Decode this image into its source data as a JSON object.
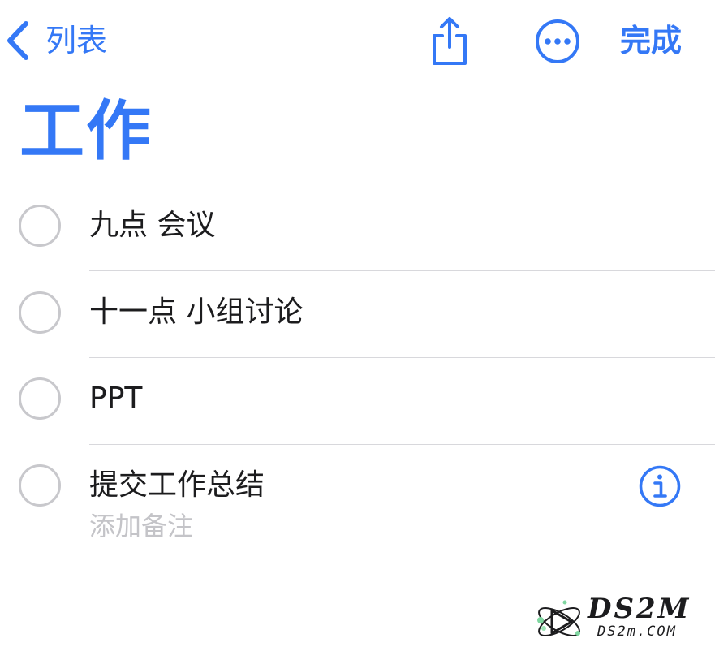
{
  "nav": {
    "back_label": "列表",
    "done_label": "完成",
    "icons": {
      "back": "chevron-left-icon",
      "share": "share-icon",
      "more": "ellipsis-circle-icon"
    }
  },
  "list": {
    "title": "工作"
  },
  "reminders": [
    {
      "title": "九点 会议",
      "completed": false
    },
    {
      "title": "十一点 小组讨论",
      "completed": false
    },
    {
      "title": "PPT",
      "completed": false
    },
    {
      "title": "提交工作总结",
      "completed": false,
      "notes_placeholder": "添加备注",
      "editing": true
    }
  ],
  "watermark": {
    "main": "DS2M",
    "sub": "DS2m.COM"
  },
  "colors": {
    "accent": "#3478f6",
    "text": "#1c1c1e",
    "circle": "#c8c8cc",
    "placeholder": "#c4c4c8",
    "divider": "#d8d8dc",
    "background": "#ffffff"
  }
}
